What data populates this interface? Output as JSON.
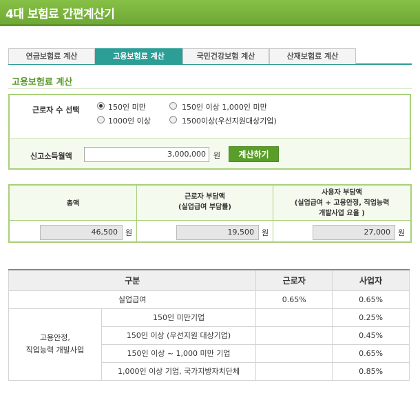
{
  "app": {
    "title": "4대 보험료 간편계산기"
  },
  "tabs": [
    {
      "label": "연금보험료 계산",
      "active": false
    },
    {
      "label": "고용보험료 계산",
      "active": true
    },
    {
      "label": "국민건강보험 계산",
      "active": false
    },
    {
      "label": "산재보험료 계산",
      "active": false
    }
  ],
  "section": {
    "title": "고용보험료 계산"
  },
  "form": {
    "worker_count_label": "근로자 수 선택",
    "options": [
      {
        "label": "150인 미만",
        "checked": true
      },
      {
        "label": "150인 이상 1,000인 미만",
        "checked": false
      },
      {
        "label": "1000인 이상",
        "checked": false
      },
      {
        "label": "1500이상(우선지원대상기업)",
        "checked": false
      }
    ],
    "income_label": "신고소득월액",
    "income_value": "3,000,000",
    "income_unit": "원",
    "calc_button": "계산하기"
  },
  "result": {
    "total_header": "총액",
    "worker_header_1": "근로자 부담액",
    "worker_header_2": "(실업급여 부담률)",
    "employer_header_1": "사용자 부담액",
    "employer_header_2": "(실업급여 + 고용안정, 직업능력",
    "employer_header_3": "개발사업 요율 )",
    "total_value": "46,500",
    "worker_value": "19,500",
    "employer_value": "27,000",
    "unit": "원"
  },
  "rates_table": {
    "headers": {
      "category": "구분",
      "worker": "근로자",
      "employer": "사업자"
    },
    "unemployment": {
      "label": "실업급여",
      "worker": "0.65%",
      "employer": "0.65%"
    },
    "group_label_1": "고용안정,",
    "group_label_2": "직업능력 개발사업",
    "rows": [
      {
        "label": "150인 미만기업",
        "worker": "",
        "employer": "0.25%"
      },
      {
        "label": "150인 이상 (우선지원 대상기업)",
        "worker": "",
        "employer": "0.45%"
      },
      {
        "label": "150인 이상 ~ 1,000 미만 기업",
        "worker": "",
        "employer": "0.65%"
      },
      {
        "label": "1,000인 이상 기업, 국가지방자치단체",
        "worker": "",
        "employer": "0.85%"
      }
    ]
  },
  "colors": {
    "brand_green": "#6fa935",
    "tab_active": "#2c9e96",
    "button_green": "#5a9e2a"
  }
}
